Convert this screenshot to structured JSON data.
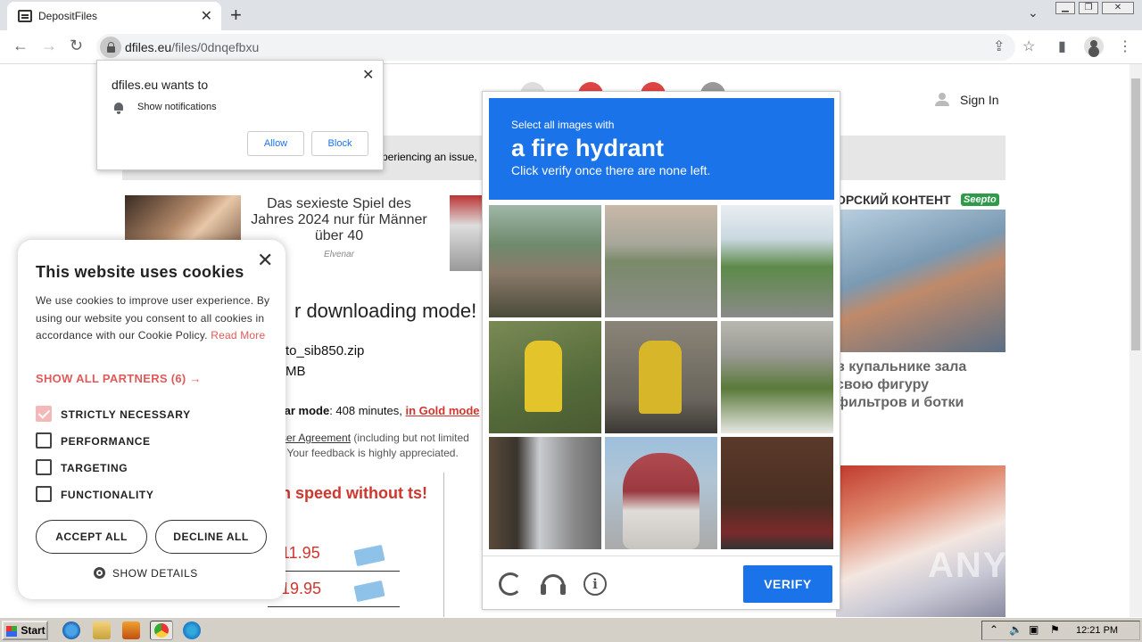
{
  "browser": {
    "tab_title": "DepositFiles",
    "url_host": "dfiles.eu",
    "url_path": "/files/0dnqefbxu"
  },
  "notification": {
    "header": "dfiles.eu wants to",
    "text": "Show notifications",
    "allow": "Allow",
    "block": "Block"
  },
  "page": {
    "sign_in": "Sign In",
    "issue_text": "xperiencing an issue,",
    "ad1_text": "Das sexieste Spiel des Jahres 2024 nur für Männer über 40",
    "ad1_source": "Elvenar",
    "download_mode": "r downloading mode!",
    "filename": "to_sib850.zip",
    "filesize": "MB",
    "free_mode_label": "lar mode",
    "free_mode_value": ": 408 minutes, ",
    "gold_mode_link": "in Gold mode",
    "agreement_link": "ser Agreement",
    "agreement_rest": " (including but not limited",
    "feedback": ". Your feedback is highly appreciated.",
    "speed_promo": "n speed without ts!",
    "price1": "11.95",
    "price2": "19.95",
    "right_title": "ОРСКИЙ КОНТЕНТ",
    "right_logo": "Seepto",
    "right_text": "в купальнике зала свою фигуру фильтров и ботки"
  },
  "cookies": {
    "title": "This website uses cookies",
    "body": "We use cookies to improve user experience. By using our website you consent to all cookies in accordance with our Cookie Policy.",
    "read_more": "Read More",
    "partners": "SHOW ALL PARTNERS (6) →",
    "options": [
      {
        "label": "STRICTLY NECESSARY",
        "checked": true
      },
      {
        "label": "PERFORMANCE",
        "checked": false
      },
      {
        "label": "TARGETING",
        "checked": false
      },
      {
        "label": "FUNCTIONALITY",
        "checked": false
      }
    ],
    "accept": "ACCEPT ALL",
    "decline": "DECLINE ALL",
    "details": "SHOW DETAILS"
  },
  "captcha": {
    "line1": "Select all images with",
    "target": "a fire hydrant",
    "line3": "Click verify once there are none left.",
    "verify": "VERIFY"
  },
  "watermark": "ANY RUN",
  "taskbar": {
    "start": "Start",
    "clock": "12:21 PM"
  }
}
